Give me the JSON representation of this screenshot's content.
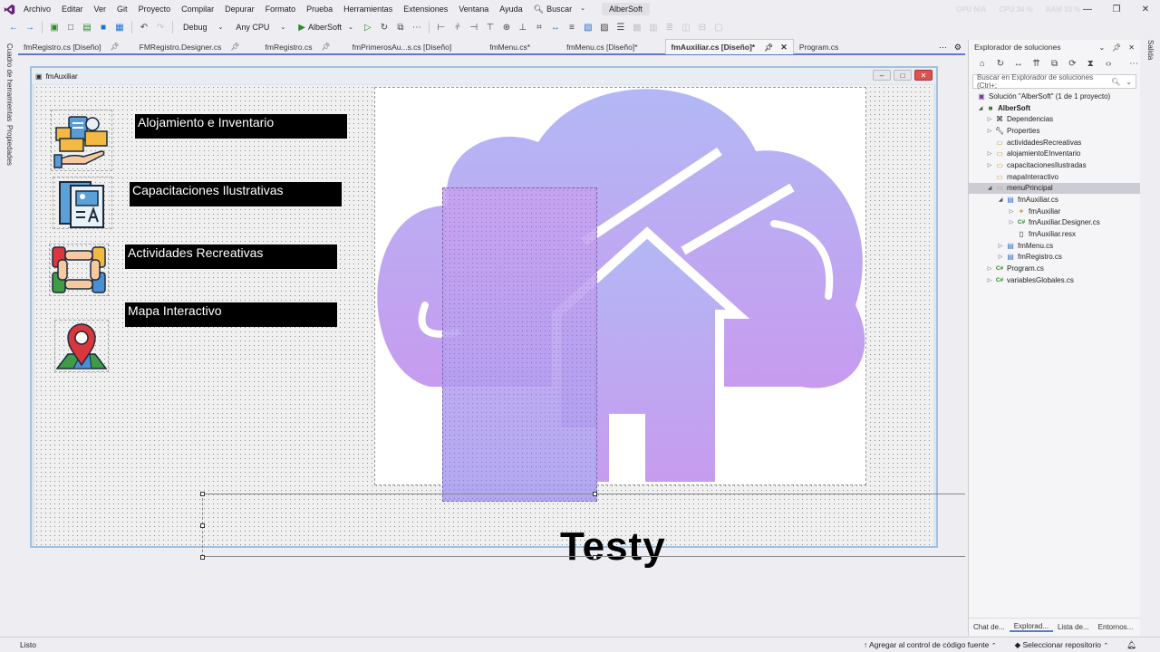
{
  "menubar": {
    "items": [
      "Archivo",
      "Editar",
      "Ver",
      "Git",
      "Proyecto",
      "Compilar",
      "Depurar",
      "Formato",
      "Prueba",
      "Herramientas",
      "Extensiones",
      "Ventana",
      "Ayuda"
    ],
    "search_label": "Buscar",
    "solution_name": "AlberSoft"
  },
  "perf": {
    "gpu": "GPU N/A",
    "cpu": "CPU 34 %",
    "ram": "RAM 33 %"
  },
  "toolbar": {
    "config": "Debug",
    "platform": "Any CPU",
    "start_label": "AlberSoft"
  },
  "left_strip": {
    "toolbox": "Cuadro de herramientas",
    "properties": "Propiedades"
  },
  "right_strip": {
    "output": "Salida"
  },
  "tabs": [
    {
      "label": "fmRegistro.cs [Diseño]",
      "pinned": true
    },
    {
      "label": "FMRegistro.Designer.cs",
      "pinned": true
    },
    {
      "label": "fmRegistro.cs",
      "pinned": true
    },
    {
      "label": "fmPrimerosAu...s.cs [Diseño]",
      "pinned": false
    },
    {
      "label": "fmMenu.cs*",
      "pinned": false
    },
    {
      "label": "fmMenu.cs [Diseño]*",
      "pinned": false
    },
    {
      "label": "fmAuxiliar.cs [Diseño]*",
      "pinned": false,
      "active": true
    },
    {
      "label": "Program.cs",
      "pinned": false
    }
  ],
  "form": {
    "title": "fmAuxiliar",
    "labels": {
      "alojamiento": "Alojamiento e Inventario",
      "capacitaciones": "Capacitaciones Ilustrativas",
      "actividades": "Actividades Recreativas",
      "mapa": "Mapa Interactivo"
    },
    "bottom_label": "Testy"
  },
  "solution_explorer": {
    "title": "Explorador de soluciones",
    "search_placeholder": "Buscar en Explorador de soluciones (Ctrl+;",
    "tree": [
      {
        "label": "Solución \"AlberSoft\" (1 de 1 proyecto)",
        "icon": "solution-icon"
      },
      {
        "label": "AlberSoft",
        "icon": "project-icon",
        "bold": true
      },
      {
        "label": "Dependencias",
        "icon": "dependencies-icon"
      },
      {
        "label": "Properties",
        "icon": "wrench-icon"
      },
      {
        "label": "actividadesRecreativas",
        "icon": "folder-icon"
      },
      {
        "label": "alojamientoEInventario",
        "icon": "folder-icon"
      },
      {
        "label": "capacitacionesIlustradas",
        "icon": "folder-icon"
      },
      {
        "label": "mapaInteractivo",
        "icon": "folder-icon"
      },
      {
        "label": "menuPrincipal",
        "icon": "folder-icon",
        "selected": true
      },
      {
        "label": "fmAuxiliar.cs",
        "icon": "form-icon"
      },
      {
        "label": "fmAuxiliar",
        "icon": "class-icon"
      },
      {
        "label": "fmAuxiliar.Designer.cs",
        "icon": "csharp-icon"
      },
      {
        "label": "fmAuxiliar.resx",
        "icon": "resource-icon"
      },
      {
        "label": "fmMenu.cs",
        "icon": "form-icon"
      },
      {
        "label": "fmRegistro.cs",
        "icon": "form-icon"
      },
      {
        "label": "Program.cs",
        "icon": "csharp-icon"
      },
      {
        "label": "variablesGlobales.cs",
        "icon": "csharp-icon"
      }
    ],
    "bottom_tabs": [
      "Chat de...",
      "Explorad...",
      "Lista de...",
      "Entornos..."
    ]
  },
  "status": {
    "text": "Listo",
    "source_control": "Agregar al control de código fuente",
    "repository": "Seleccionar repositorio"
  }
}
